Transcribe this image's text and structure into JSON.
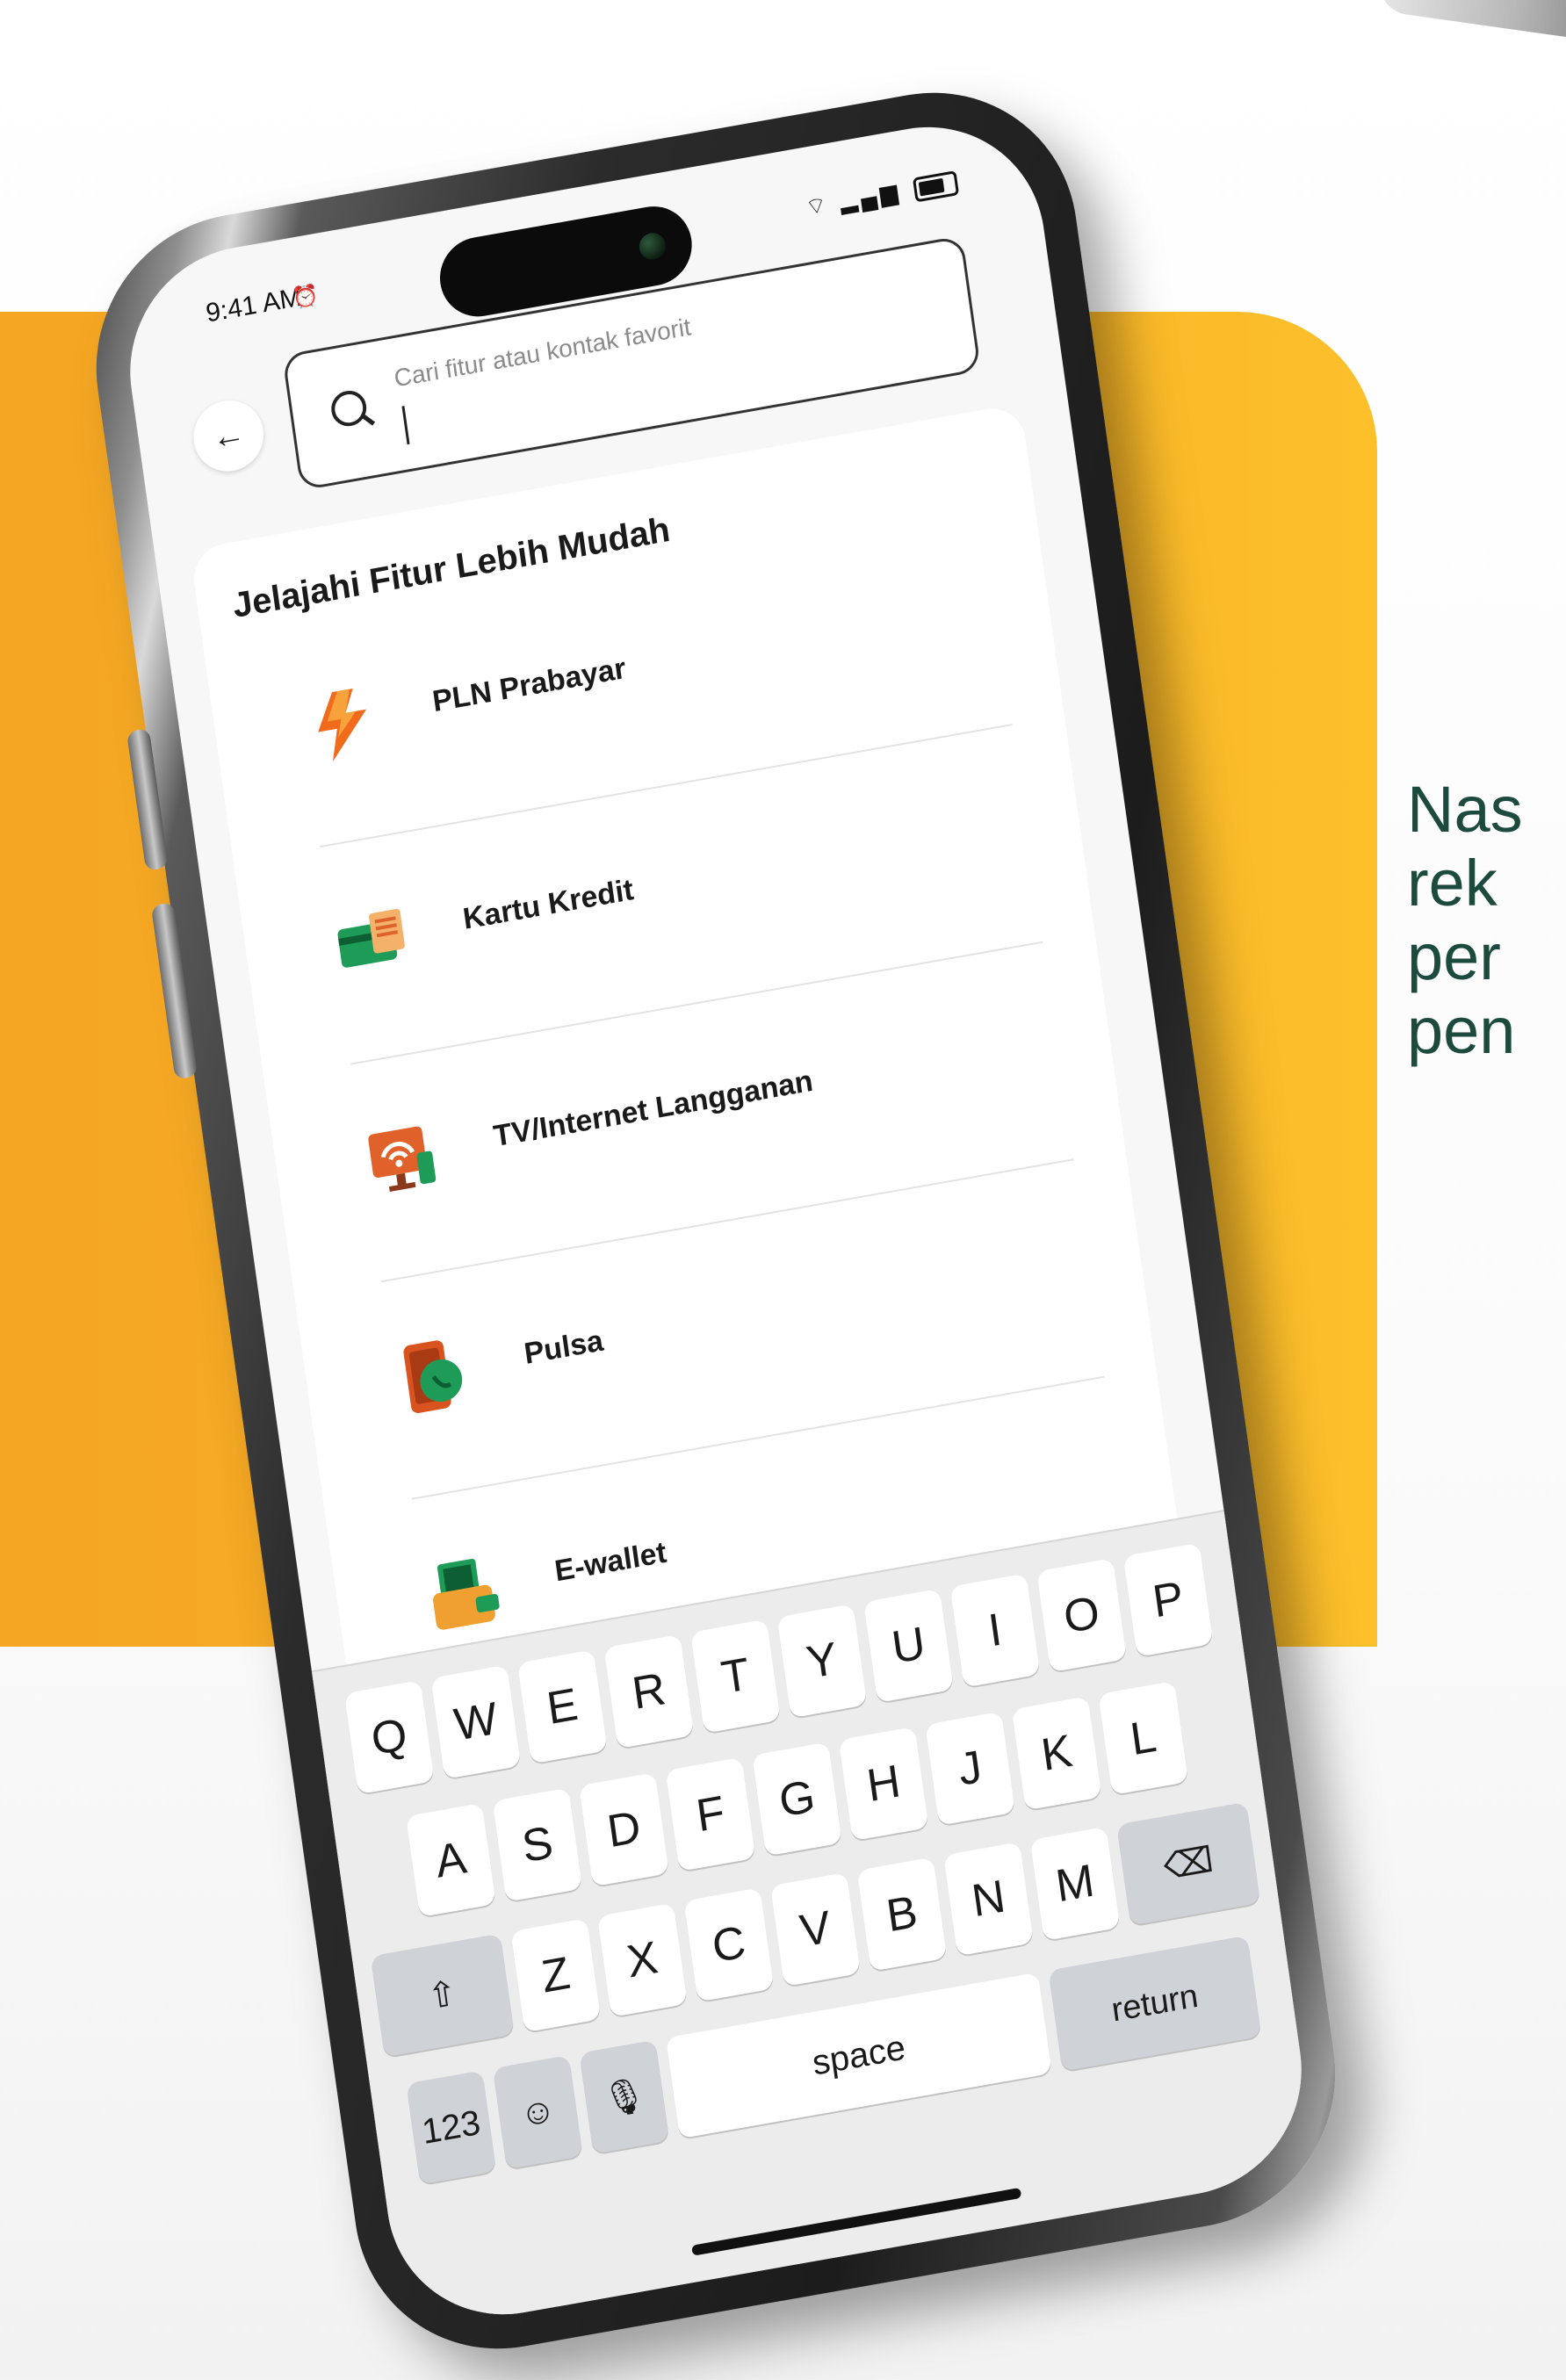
{
  "status_bar": {
    "time": "9:41 AM",
    "alarm_icon": "alarm-clock-icon",
    "signal_icons": "wifi signal battery"
  },
  "search": {
    "placeholder": "Cari fitur atau kontak favorit",
    "value": ""
  },
  "section": {
    "title": "Jelajahi Fitur Lebih Mudah"
  },
  "menu": {
    "items": [
      {
        "label": "PLN Prabayar",
        "icon": "lightning-bolt-icon",
        "color": "#f26b1d"
      },
      {
        "label": "Kartu Kredit",
        "icon": "credit-card-icon",
        "color": "#1e9c57"
      },
      {
        "label": "TV/Internet Langganan",
        "icon": "tv-wifi-icon",
        "color": "#e0622a"
      },
      {
        "label": "Pulsa",
        "icon": "mobile-phone-icon",
        "color": "#d9531e"
      },
      {
        "label": "E-wallet",
        "icon": "wallet-icon",
        "color": "#1e9c57"
      }
    ]
  },
  "keyboard": {
    "row1": [
      "Q",
      "W",
      "E",
      "R",
      "T",
      "Y",
      "U",
      "I",
      "O",
      "P"
    ],
    "row2": [
      "A",
      "S",
      "D",
      "F",
      "G",
      "H",
      "J",
      "K",
      "L"
    ],
    "row3": [
      "Z",
      "X",
      "C",
      "V",
      "B",
      "N",
      "M"
    ],
    "numbers_label": "123",
    "space_label": "space",
    "return_label": "return"
  },
  "side_text": "Nas\nrek\nper\npen",
  "colors": {
    "accent_orange": "#f5a623",
    "accent_green": "#1d4a3f"
  }
}
